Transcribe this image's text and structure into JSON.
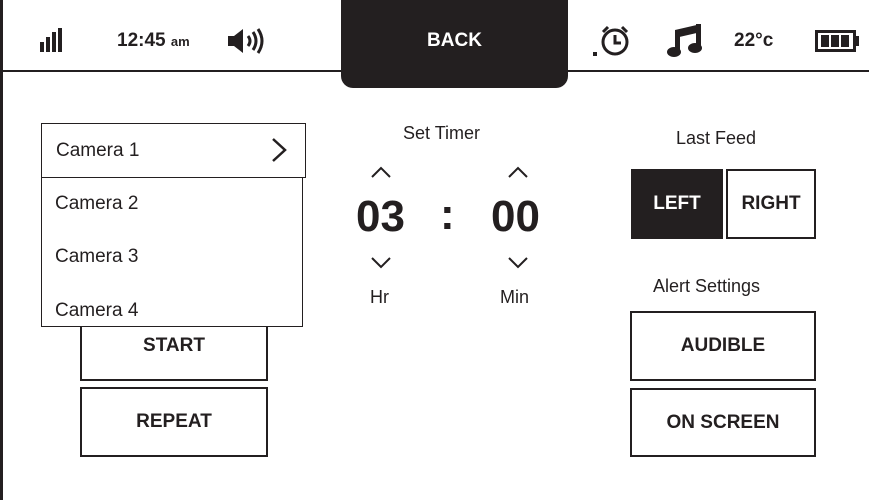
{
  "status_bar": {
    "time": "12:45",
    "ampm": "am",
    "temperature": "22°c",
    "icons": [
      "signal-icon",
      "speaker-volume-icon",
      "alarm-clock-icon",
      "music-note-icon",
      "battery-icon"
    ]
  },
  "nav": {
    "back_label": "BACK"
  },
  "camera_dropdown": {
    "selected": "Camera 1",
    "options": [
      "Camera 2",
      "Camera 3",
      "Camera 4"
    ]
  },
  "timer": {
    "title": "Set Timer",
    "hours": "03",
    "separator": ":",
    "minutes": "00",
    "hours_label": "Hr",
    "minutes_label": "Min"
  },
  "actions": {
    "start_label": "START",
    "repeat_label": "REPEAT"
  },
  "last_feed": {
    "title": "Last Feed",
    "left_label": "LEFT",
    "right_label": "RIGHT",
    "selected": "LEFT"
  },
  "alert_settings": {
    "title": "Alert Settings",
    "audible_label": "AUDIBLE",
    "on_screen_label": "ON SCREEN"
  },
  "colors": {
    "ink": "#231f20",
    "background": "#ffffff"
  }
}
